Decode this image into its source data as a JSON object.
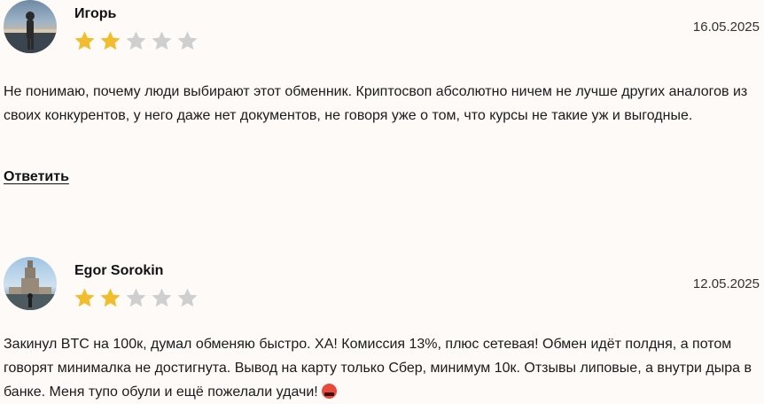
{
  "reviews": [
    {
      "author": "Игорь",
      "date": "16.05.2025",
      "rating": 2,
      "max_rating": 5,
      "text": "Не понимаю, почему люди выбирают этот обменник. Криптосвоп абсолютно ничем не лучше других аналогов из своих конкурентов, у него даже нет документов, не говоря уже о том, что курсы не такие уж и выгодные.",
      "reply_label": "Ответить"
    },
    {
      "author": "Egor Sorokin",
      "date": "12.05.2025",
      "rating": 2,
      "max_rating": 5,
      "text": "Закинул BTC на 100к, думал обменяю быстро. ХА! Комиссия 13%, плюс сетевая! Обмен идёт полдня, а потом говорят минималка не достигнута. Вывод на карту только Сбер, минимум 10к. Отзывы липовые, а внутри дыра в банке. Меня тупо обули и ещё пожелали удачи!"
    }
  ],
  "colors": {
    "star_filled": "#f2bd2c",
    "star_empty": "#cfcfcf",
    "background": "#fdfaf7"
  }
}
